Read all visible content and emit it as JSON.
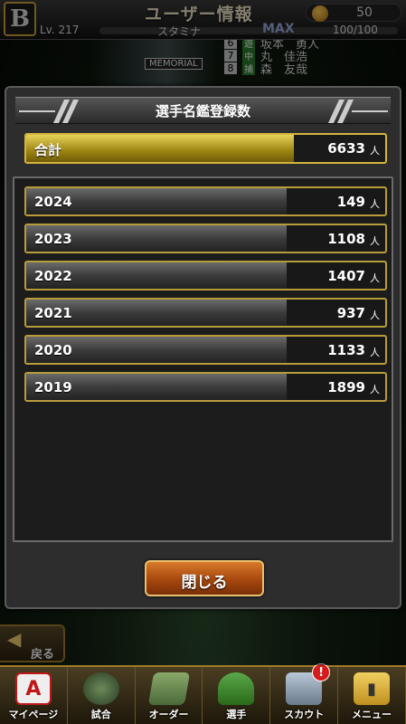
{
  "header": {
    "title": "ユーザー情報",
    "level": "Lv. 217",
    "stamina_label": "スタミナ",
    "stamina_max": "MAX",
    "stamina_value": "100/100",
    "coins": "50",
    "team_logo": "B"
  },
  "background_roster": [
    {
      "number": "6",
      "position": "遊",
      "name": "坂本　勇人"
    },
    {
      "number": "7",
      "position": "中",
      "name": "丸　佳浩"
    },
    {
      "number": "8",
      "position": "捕",
      "name": "森　友哉"
    }
  ],
  "background_tag": "MEMORIAL",
  "modal": {
    "title": "選手名鑑登録数",
    "total": {
      "label": "合計",
      "value": "6633",
      "unit": "人"
    },
    "years": [
      {
        "label": "2024",
        "value": "149",
        "unit": "人"
      },
      {
        "label": "2023",
        "value": "1108",
        "unit": "人"
      },
      {
        "label": "2022",
        "value": "1407",
        "unit": "人"
      },
      {
        "label": "2021",
        "value": "937",
        "unit": "人"
      },
      {
        "label": "2020",
        "value": "1133",
        "unit": "人"
      },
      {
        "label": "2019",
        "value": "1899",
        "unit": "人"
      }
    ],
    "close_label": "閉じる"
  },
  "back_button": {
    "label": "戻る"
  },
  "bottom_nav": [
    {
      "label": "マイページ",
      "icon": "a-logo-icon"
    },
    {
      "label": "試合",
      "icon": "stadium-icon"
    },
    {
      "label": "オーダー",
      "icon": "field-icon"
    },
    {
      "label": "選手",
      "icon": "player-icon"
    },
    {
      "label": "スカウト",
      "icon": "scout-icon",
      "badge": "!"
    },
    {
      "label": "メニュー",
      "icon": "menu-icon"
    }
  ],
  "colors": {
    "gold_accent": "#d4b53c",
    "close_button": "#b9520f",
    "badge_red": "#d41c1c"
  }
}
